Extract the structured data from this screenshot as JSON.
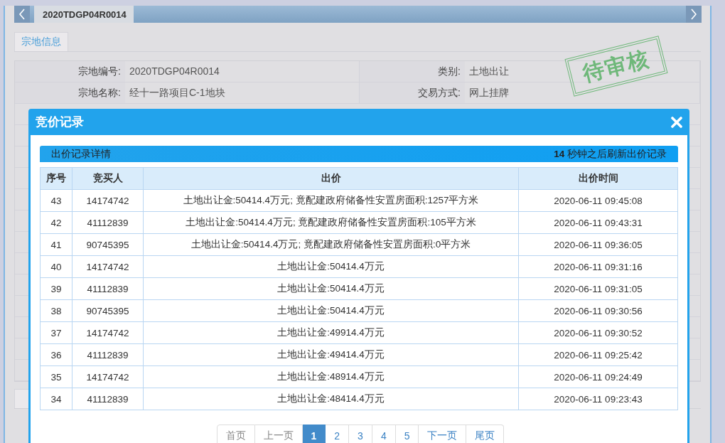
{
  "tabs": [
    {
      "label": "2020TDGP04R0014",
      "selected": true
    }
  ],
  "section_tab": "宗地信息",
  "info_rows": [
    [
      {
        "label": "宗地编号:",
        "value": "2020TDGP04R0014"
      },
      {
        "label": "类别:",
        "value": "土地出让"
      }
    ],
    [
      {
        "label": "宗地名称:",
        "value": "经十一路项目C-1地块"
      },
      {
        "label": "交易方式:",
        "value": "网上挂牌"
      }
    ]
  ],
  "stamp": "待审核",
  "dialog": {
    "title": "竞价记录",
    "detail_bar": {
      "title": "出价记录详情",
      "refresh": "**14** 秒钟之后刷新出价记录"
    },
    "table": {
      "columns": [
        "序号",
        "竞买人",
        "出价",
        "出价时间"
      ],
      "rows": [
        [
          "43",
          "14174742",
          "土地出让金:50414.4万元; 竟配建政府储备性安置房面积:1257平方米",
          "2020-06-11 09:45:08"
        ],
        [
          "42",
          "41112839",
          "土地出让金:50414.4万元; 竟配建政府储备性安置房面积:105平方米",
          "2020-06-11 09:43:31"
        ],
        [
          "41",
          "90745395",
          "土地出让金:50414.4万元; 竟配建政府储备性安置房面积:0平方米",
          "2020-06-11 09:36:05"
        ],
        [
          "40",
          "14174742",
          "土地出让金:50414.4万元",
          "2020-06-11 09:31:16"
        ],
        [
          "39",
          "41112839",
          "土地出让金:50414.4万元",
          "2020-06-11 09:31:05"
        ],
        [
          "38",
          "90745395",
          "土地出让金:50414.4万元",
          "2020-06-11 09:30:56"
        ],
        [
          "37",
          "14174742",
          "土地出让金:49914.4万元",
          "2020-06-11 09:30:52"
        ],
        [
          "36",
          "41112839",
          "土地出让金:49414.4万元",
          "2020-06-11 09:25:42"
        ],
        [
          "35",
          "14174742",
          "土地出让金:48914.4万元",
          "2020-06-11 09:24:49"
        ],
        [
          "34",
          "41112839",
          "土地出让金:48414.4万元",
          "2020-06-11 09:23:43"
        ]
      ]
    },
    "pagination": [
      {
        "label": "首页",
        "selected": false,
        "disabled": true
      },
      {
        "label": "上一页",
        "selected": false,
        "disabled": true
      },
      {
        "label": "1",
        "selected": true,
        "disabled": false
      },
      {
        "label": "2",
        "selected": false,
        "disabled": false
      },
      {
        "label": "3",
        "selected": false,
        "disabled": false
      },
      {
        "label": "4",
        "selected": false,
        "disabled": false
      },
      {
        "label": "5",
        "selected": false,
        "disabled": false
      },
      {
        "label": "下一页",
        "selected": false,
        "disabled": false
      },
      {
        "label": "尾页",
        "selected": false,
        "disabled": false
      }
    ]
  }
}
